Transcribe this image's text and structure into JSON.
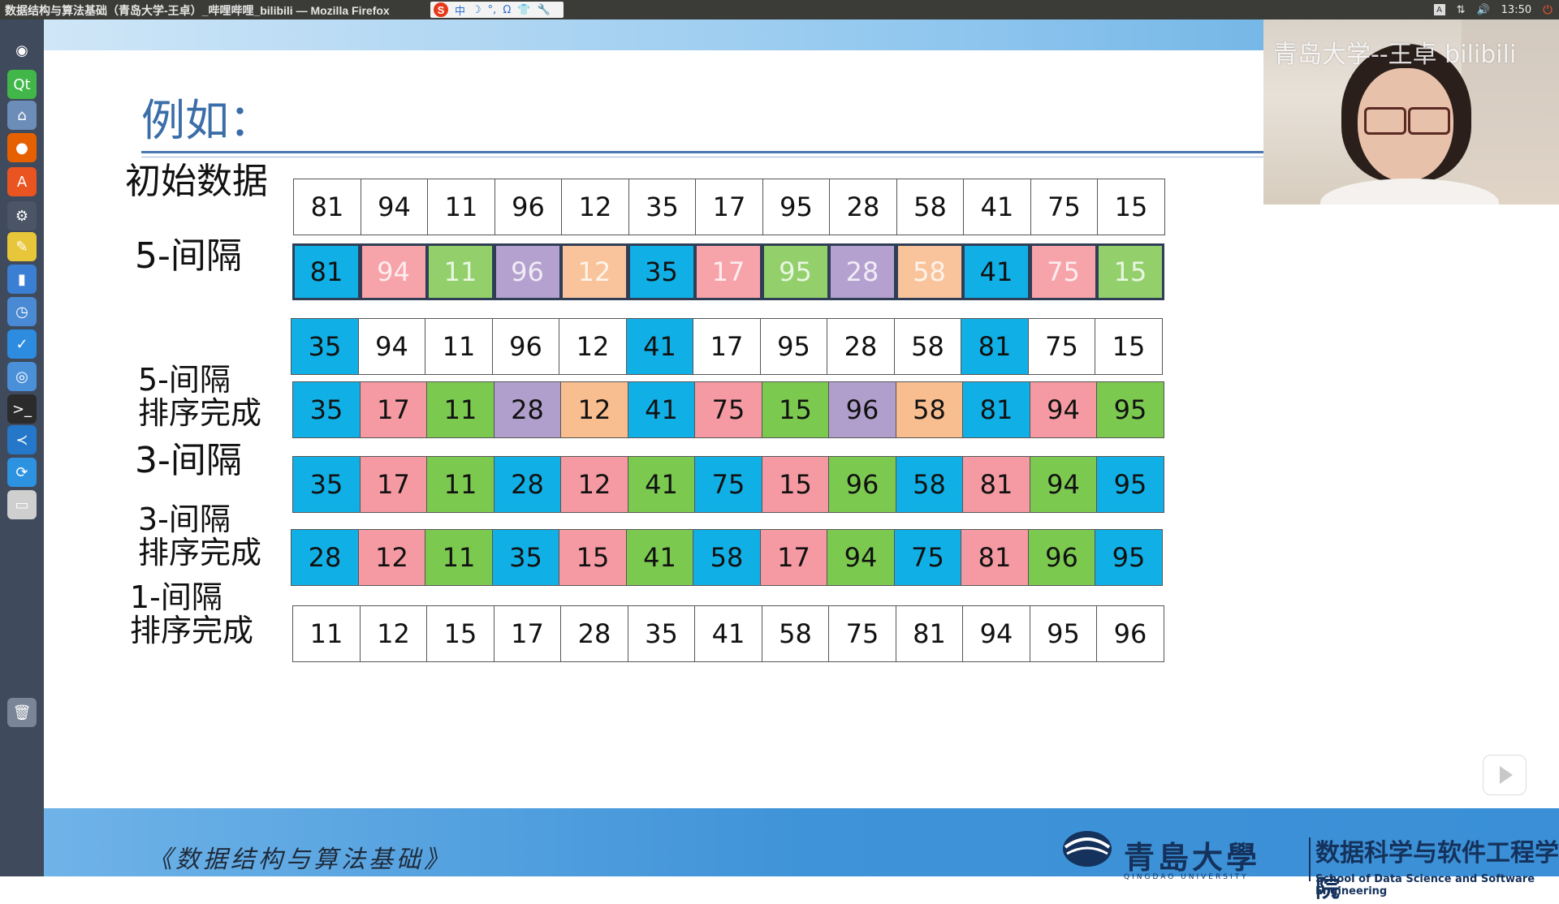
{
  "window": {
    "title": "数据结构与算法基础（青岛大学-王卓）_哔哩哔哩_bilibili — Mozilla Firefox"
  },
  "ime_toolbar": {
    "logo": "S",
    "glyphs": [
      "中",
      "☽",
      "°,",
      "Ω",
      "👕",
      "🔧"
    ]
  },
  "system_tray": {
    "keyboard": "A",
    "network_icon": "network-icon",
    "volume_icon": "volume-icon",
    "time": "13:50",
    "power_icon": "power-icon"
  },
  "launcher": {
    "items": [
      {
        "name": "ubuntu-dash-icon",
        "color": "#3f4a5c",
        "glyph": "◉"
      },
      {
        "name": "qt-creator-icon",
        "color": "#41b649",
        "glyph": "Qt"
      },
      {
        "name": "files-icon",
        "color": "#6b8db8",
        "glyph": "⌂"
      },
      {
        "name": "firefox-icon",
        "color": "#e66000",
        "glyph": "●"
      },
      {
        "name": "software-center-icon",
        "color": "#e95420",
        "glyph": "A"
      },
      {
        "name": "settings-icon",
        "color": "#4b5566",
        "glyph": "⚙"
      },
      {
        "name": "text-editor-icon",
        "color": "#e8c63a",
        "glyph": "✎"
      },
      {
        "name": "monitor-icon",
        "color": "#3a7fd4",
        "glyph": "▮"
      },
      {
        "name": "clock-icon",
        "color": "#4a8ad4",
        "glyph": "◷"
      },
      {
        "name": "notes-icon",
        "color": "#2d8be0",
        "glyph": "✓"
      },
      {
        "name": "chrome-icon",
        "color": "#4a90d9",
        "glyph": "◎"
      },
      {
        "name": "terminal-icon",
        "color": "#2b2b2b",
        "glyph": ">_"
      },
      {
        "name": "vscode-icon",
        "color": "#2477c9",
        "glyph": "≺"
      },
      {
        "name": "updater-icon",
        "color": "#2d92e0",
        "glyph": "⟳"
      },
      {
        "name": "drive-icon",
        "color": "#cfcfcf",
        "glyph": "▭"
      },
      {
        "name": "trash-icon",
        "color": "#7a8597",
        "glyph": "🗑"
      }
    ]
  },
  "slide": {
    "heading": "例如：",
    "rows": [
      {
        "label": "初始数据",
        "values": [
          "81",
          "94",
          "11",
          "96",
          "12",
          "35",
          "17",
          "95",
          "28",
          "58",
          "41",
          "75",
          "15"
        ],
        "colors": [
          "#ffffff",
          "#ffffff",
          "#ffffff",
          "#ffffff",
          "#ffffff",
          "#ffffff",
          "#ffffff",
          "#ffffff",
          "#ffffff",
          "#ffffff",
          "#ffffff",
          "#ffffff",
          "#ffffff"
        ],
        "faded": [
          false,
          false,
          false,
          false,
          false,
          false,
          false,
          false,
          false,
          false,
          false,
          false,
          false
        ]
      },
      {
        "label": "5-间隔",
        "values": [
          "81",
          "94",
          "11",
          "96",
          "12",
          "35",
          "17",
          "95",
          "28",
          "58",
          "41",
          "75",
          "15"
        ],
        "colors": [
          "#10b0e6",
          "#f7a3aa",
          "#93d06c",
          "#b5a1cf",
          "#f9c49b",
          "#10b0e6",
          "#f7a3aa",
          "#93d06c",
          "#b5a1cf",
          "#f9c49b",
          "#10b0e6",
          "#f7a3aa",
          "#93d06c"
        ],
        "faded": [
          false,
          true,
          true,
          true,
          true,
          false,
          true,
          true,
          true,
          true,
          false,
          true,
          true
        ]
      },
      {
        "label": "",
        "values": [
          "35",
          "94",
          "11",
          "96",
          "12",
          "41",
          "17",
          "95",
          "28",
          "58",
          "81",
          "75",
          "15"
        ],
        "colors": [
          "#10b0e6",
          "#ffffff",
          "#ffffff",
          "#ffffff",
          "#ffffff",
          "#10b0e6",
          "#ffffff",
          "#ffffff",
          "#ffffff",
          "#ffffff",
          "#10b0e6",
          "#ffffff",
          "#ffffff"
        ],
        "faded": [
          false,
          false,
          false,
          false,
          false,
          false,
          false,
          false,
          false,
          false,
          false,
          false,
          false
        ]
      },
      {
        "label": "5-间隔\n排序完成",
        "values": [
          "35",
          "17",
          "11",
          "28",
          "12",
          "41",
          "75",
          "15",
          "96",
          "58",
          "81",
          "94",
          "95"
        ],
        "colors": [
          "#10b0e6",
          "#f59aa2",
          "#7cc950",
          "#b09fcc",
          "#f9be90",
          "#10b0e6",
          "#f59aa2",
          "#7cc950",
          "#b09fcc",
          "#f9be90",
          "#10b0e6",
          "#f59aa2",
          "#7cc950"
        ],
        "faded": [
          false,
          false,
          false,
          false,
          false,
          false,
          false,
          false,
          false,
          false,
          false,
          false,
          false
        ]
      },
      {
        "label": "3-间隔",
        "values": [
          "35",
          "17",
          "11",
          "28",
          "12",
          "41",
          "75",
          "15",
          "96",
          "58",
          "81",
          "94",
          "95"
        ],
        "colors": [
          "#10b0e6",
          "#f59aa2",
          "#7cc950",
          "#10b0e6",
          "#f59aa2",
          "#7cc950",
          "#10b0e6",
          "#f59aa2",
          "#7cc950",
          "#10b0e6",
          "#f59aa2",
          "#7cc950",
          "#10b0e6"
        ],
        "faded": [
          false,
          false,
          false,
          false,
          false,
          false,
          false,
          false,
          false,
          false,
          false,
          false,
          false
        ]
      },
      {
        "label": "3-间隔\n排序完成",
        "values": [
          "28",
          "12",
          "11",
          "35",
          "15",
          "41",
          "58",
          "17",
          "94",
          "75",
          "81",
          "96",
          "95"
        ],
        "colors": [
          "#10b0e6",
          "#f59aa2",
          "#7cc950",
          "#10b0e6",
          "#f59aa2",
          "#7cc950",
          "#10b0e6",
          "#f59aa2",
          "#7cc950",
          "#10b0e6",
          "#f59aa2",
          "#7cc950",
          "#10b0e6"
        ],
        "faded": [
          false,
          false,
          false,
          false,
          false,
          false,
          false,
          false,
          false,
          false,
          false,
          false,
          false
        ]
      },
      {
        "label": "1-间隔\n排序完成",
        "values": [
          "11",
          "12",
          "15",
          "17",
          "28",
          "35",
          "41",
          "58",
          "75",
          "81",
          "94",
          "95",
          "96"
        ],
        "colors": [
          "#ffffff",
          "#ffffff",
          "#ffffff",
          "#ffffff",
          "#ffffff",
          "#ffffff",
          "#ffffff",
          "#ffffff",
          "#ffffff",
          "#ffffff",
          "#ffffff",
          "#ffffff",
          "#ffffff"
        ],
        "faded": [
          false,
          false,
          false,
          false,
          false,
          false,
          false,
          false,
          false,
          false,
          false,
          false,
          false
        ]
      }
    ],
    "footer": {
      "course": "《数据结构与算法基础》",
      "university_cn": "青島大學",
      "university_en": "QINGDAO UNIVERSITY",
      "school_cn": "数据科学与软件工程学院",
      "school_en": "School of Data Science and Software Engineering"
    }
  },
  "webcam": {
    "label": "青岛大学--王卓 bilibili"
  },
  "player": {
    "play_icon": "play-icon"
  },
  "colors": {
    "blue": "#10b0e6",
    "pink": "#f59aa2",
    "green": "#7cc950",
    "purple": "#b09fcc",
    "peach": "#f9be90",
    "heading": "#3b6ea8"
  }
}
